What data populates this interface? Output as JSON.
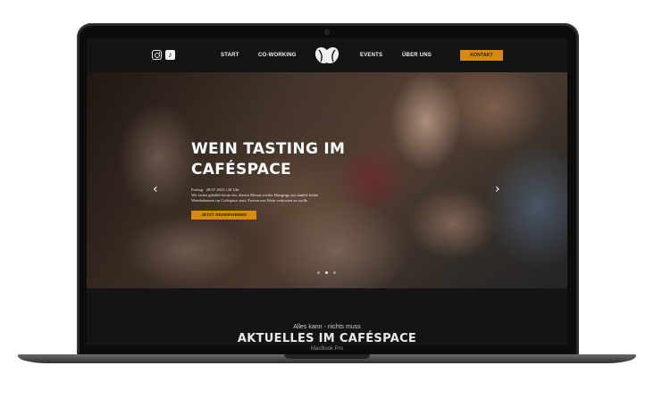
{
  "device": {
    "model_label": "MacBook Pro"
  },
  "header": {
    "social": [
      {
        "icon": "instagram-icon"
      },
      {
        "icon": "tiktok-icon"
      }
    ],
    "nav": {
      "start": "START",
      "coworking": "CO-WORKING",
      "events": "EVENTS",
      "about": "ÜBER UNS"
    },
    "logo_icon": "coffee-bean-heart-logo",
    "contact_button": "KONTAKT"
  },
  "hero": {
    "title_line1": "WEIN TASTING IM",
    "title_line2": "CAFÉSPACE",
    "desc_line1": "Freitag · 28.07.2023 | 20 Uhr",
    "desc_line2": "Wir laden gekühlt heute ein, diesen Monat wieder Hungrige zur dunkle kühle",
    "desc_line3": "Weinbekannte im Caféspace statt. Freuen uns Wein verkosten zu wolle",
    "button": "JETZT RESERVIEREN",
    "prev_arrow": "‹",
    "next_arrow": "›",
    "slides_total": 3,
    "active_slide": 2
  },
  "section": {
    "tagline": "Alles kann - nichts muss",
    "heading": "AKTUELLES IM CAFÉSPACE"
  },
  "colors": {
    "accent": "#d68a10",
    "background": "#141414",
    "text": "#ffffff"
  }
}
